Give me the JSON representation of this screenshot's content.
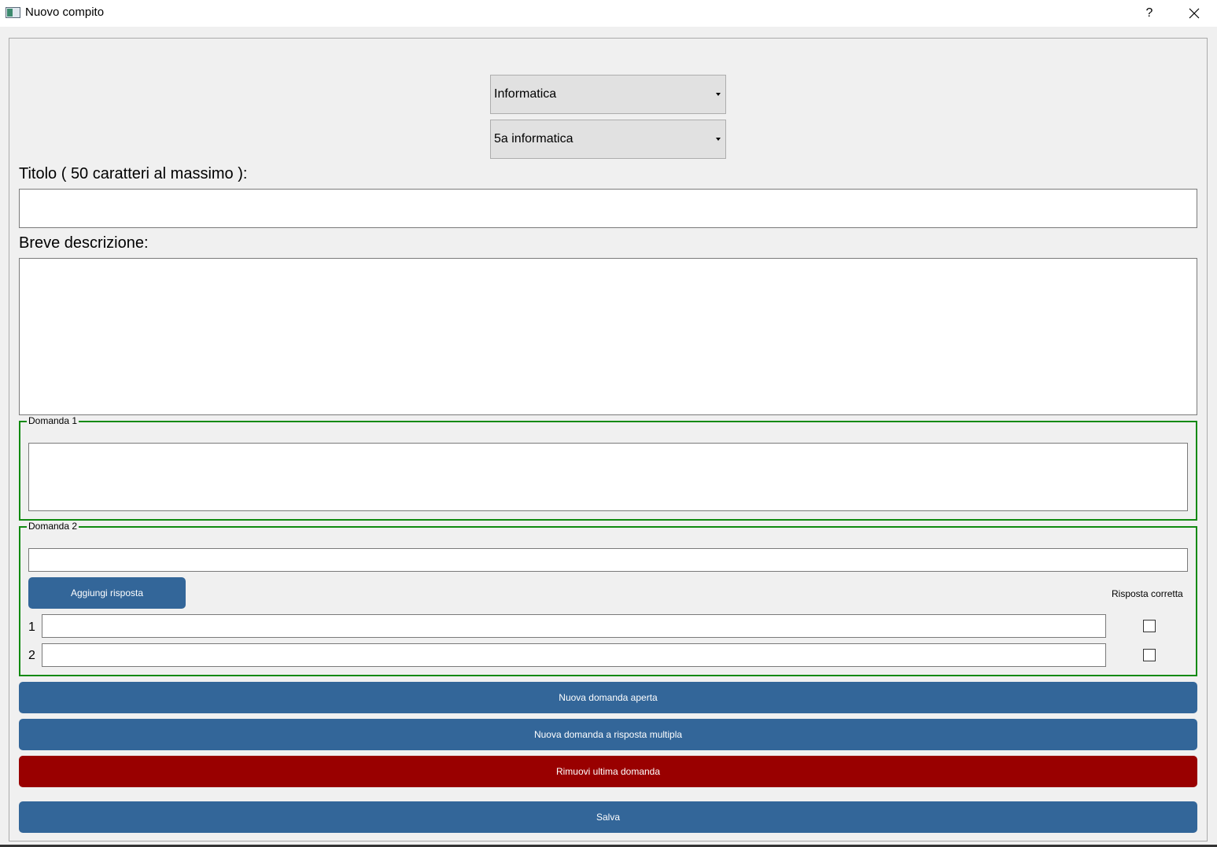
{
  "window": {
    "title": "Nuovo compito",
    "help_label": "?"
  },
  "form": {
    "subject_select": "Informatica",
    "class_select": "5a informatica",
    "title_label": "Titolo ( 50 caratteri al massimo ):",
    "title_value": "",
    "description_label": "Breve descrizione:",
    "description_value": ""
  },
  "questions": [
    {
      "title": "Domanda 1",
      "type": "open",
      "text": ""
    },
    {
      "title": "Domanda 2",
      "type": "multiple",
      "text": "",
      "add_answer_label": "Aggiungi risposta",
      "correct_answer_header": "Risposta corretta",
      "answers": [
        {
          "number": "1",
          "text": "",
          "correct": false
        },
        {
          "number": "2",
          "text": "",
          "correct": false
        }
      ]
    }
  ],
  "actions": {
    "new_open_label": "Nuova domanda aperta",
    "new_multiple_label": "Nuova domanda a risposta multipla",
    "remove_last_label": "Rimuovi ultima domanda",
    "save_label": "Salva"
  },
  "colors": {
    "primary_button": "#336699",
    "danger_button": "#990000",
    "group_border": "#118a11"
  }
}
